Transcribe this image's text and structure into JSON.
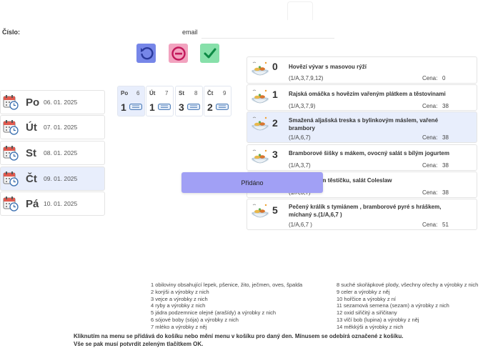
{
  "header": {
    "cislo_label": "Číslo:",
    "email_label": "email"
  },
  "actions": [
    {
      "name": "reset",
      "icon": "undo-icon",
      "color": "#7686e8"
    },
    {
      "name": "remove",
      "icon": "minus-circle-icon",
      "color": "#f2a3bf"
    },
    {
      "name": "confirm",
      "icon": "check-icon",
      "color": "#87e0aa"
    }
  ],
  "days": [
    {
      "name": "Po",
      "date": "06. 01. 2025",
      "selected": false
    },
    {
      "name": "Út",
      "date": "07. 01. 2025",
      "selected": false
    },
    {
      "name": "St",
      "date": "08. 01. 2025",
      "selected": false
    },
    {
      "name": "Čt",
      "date": "09. 01. 2025",
      "selected": true
    },
    {
      "name": "Pá",
      "date": "10. 01. 2025",
      "selected": false
    }
  ],
  "cart": [
    {
      "day": "Po",
      "menu": "6",
      "qty": "1",
      "active": true
    },
    {
      "day": "Út",
      "menu": "7",
      "qty": "1",
      "active": false
    },
    {
      "day": "St",
      "menu": "8",
      "qty": "3",
      "active": false
    },
    {
      "day": "Čt",
      "menu": "9",
      "qty": "2",
      "active": false
    }
  ],
  "menu": [
    {
      "num": "0",
      "name": "Hovězí vývar s masovou rýží",
      "allergens": "(1/A,3,7,9,12)",
      "price_label": "Cena:",
      "price": "0",
      "selected": false
    },
    {
      "num": "1",
      "name": "Rajská omáčka s hovězím vařeným plátkem a těstovinami",
      "allergens": "(1/A,3,7,9)",
      "price_label": "Cena:",
      "price": "38",
      "selected": false
    },
    {
      "num": "2",
      "name": "Smažená aljašská treska s bylinkovým máslem, vařené brambory",
      "allergens": "(1/A,6,7)",
      "price_label": "Cena:",
      "price": "38",
      "selected": true
    },
    {
      "num": "3",
      "name": "Bramborové šišky s mákem, ovocný salát s bílým jogurtem",
      "allergens": "(1/A,3,7)",
      "price_label": "Cena:",
      "price": "38",
      "selected": false
    },
    {
      "num": "4",
      "name": "…t v sýrovém těstíčku, salát Coleslaw",
      "allergens": "(1/A,3,7)",
      "price_label": "Cena:",
      "price": "38",
      "selected": false
    },
    {
      "num": "5",
      "name": "Pečený králík s tymiánem , bramborové pyré s hráškem, míchaný s.(1/A,6,7 )",
      "allergens": "(1/A,6,7 )",
      "price_label": "Cena:",
      "price": "51",
      "selected": false
    }
  ],
  "toast": "Přidáno",
  "allergens_left": [
    "1 obiloviny obsahující lepek, pšenice, žito, ječmen, oves, špalda",
    "2 korýši a výrobky z nich",
    "3 vejce a výrobky z nich",
    "4 ryby a výrobky z nich",
    "5 jádra podzemnice olejné (arašídy) a výrobky z nich",
    "6 sójové boby (sója) a výrobky z nich",
    "7 mléko a výrobky z něj"
  ],
  "allergens_right": [
    "8 suché skořápkové plody, všechny ořechy a výrobky z nich",
    "9 celer a výrobky z něj",
    "10 hořčice a výrobky z ní",
    "11 sezamová semena (sezam) a výrobky z nich",
    "12 oxid siřičitý a siřičitany",
    "13 vlčí bob (lupina) a výrobky z něj",
    "14 měkkýši a výrobky z nich"
  ],
  "notes": [
    "Kliknutím na menu se přidává do košíku nebo mění menu v košíku pro daný den. Mínusem se odebírá označené z košíku.",
    "Vše se pak musí potvrdit zeleným tlačítkem OK."
  ]
}
